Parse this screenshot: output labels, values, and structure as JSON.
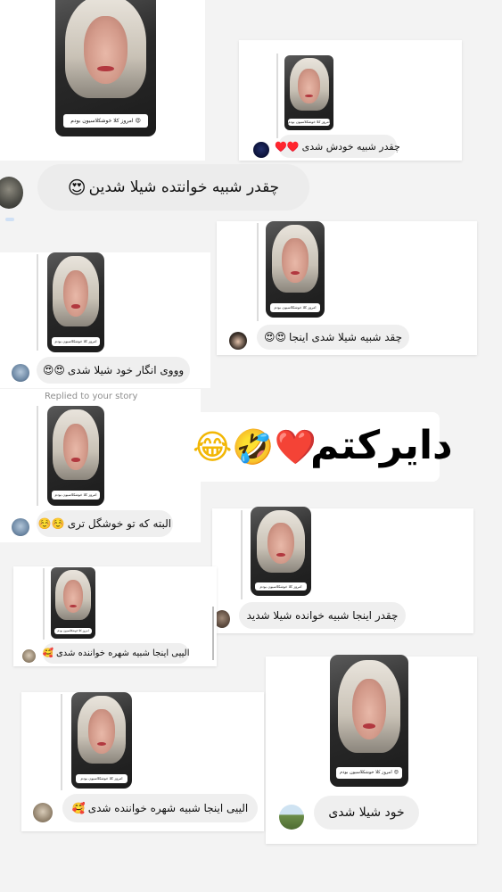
{
  "story_caption": "امروز کلا خوشکلاسیون بودم",
  "story_caption_emoji": "😍",
  "replied_label": "Replied to your story",
  "overlay": {
    "text": "دایرکتم",
    "emojis": "😂🤣❤️"
  },
  "messages": [
    {
      "text": "چقدر شبیه خودش شدی",
      "emoji": "♥️♥️",
      "avatar": "avatar-dark-circle"
    },
    {
      "text": "چقدر شبیه خوانتده شیلا شدین",
      "emoji": "😍",
      "avatar": "avatar-user-photo"
    },
    {
      "text": "چقد شبیه شیلا شدی اینجا",
      "emoji": "😍😍",
      "avatar": "avatar-girl-photo"
    },
    {
      "text": "وووی انگار خود شیلا شدی",
      "emoji": "😍😍",
      "avatar": "avatar-user-photo"
    },
    {
      "text": "البته که تو خوشگل تری",
      "emoji": "☺️☺️",
      "avatar": "avatar-user-photo"
    },
    {
      "text": "چقدر اینجا شبیه خوانده شیلا شدید",
      "emoji": "",
      "avatar": "avatar-user-photo"
    },
    {
      "text": "الییی اینجا شبیه شهره خواننده شدی",
      "emoji": "🥰",
      "avatar": "avatar-user-photo"
    },
    {
      "text": "الییی اینجا شبیه شهره خواننده شدی",
      "emoji": "🥰",
      "avatar": "avatar-user-photo"
    },
    {
      "text": "خود شیلا شدی",
      "emoji": "",
      "avatar": "avatar-landscape-photo"
    }
  ],
  "colors": {
    "bubble": "#efefef",
    "background": "#f3f3f3",
    "heart": "#e0242d"
  }
}
